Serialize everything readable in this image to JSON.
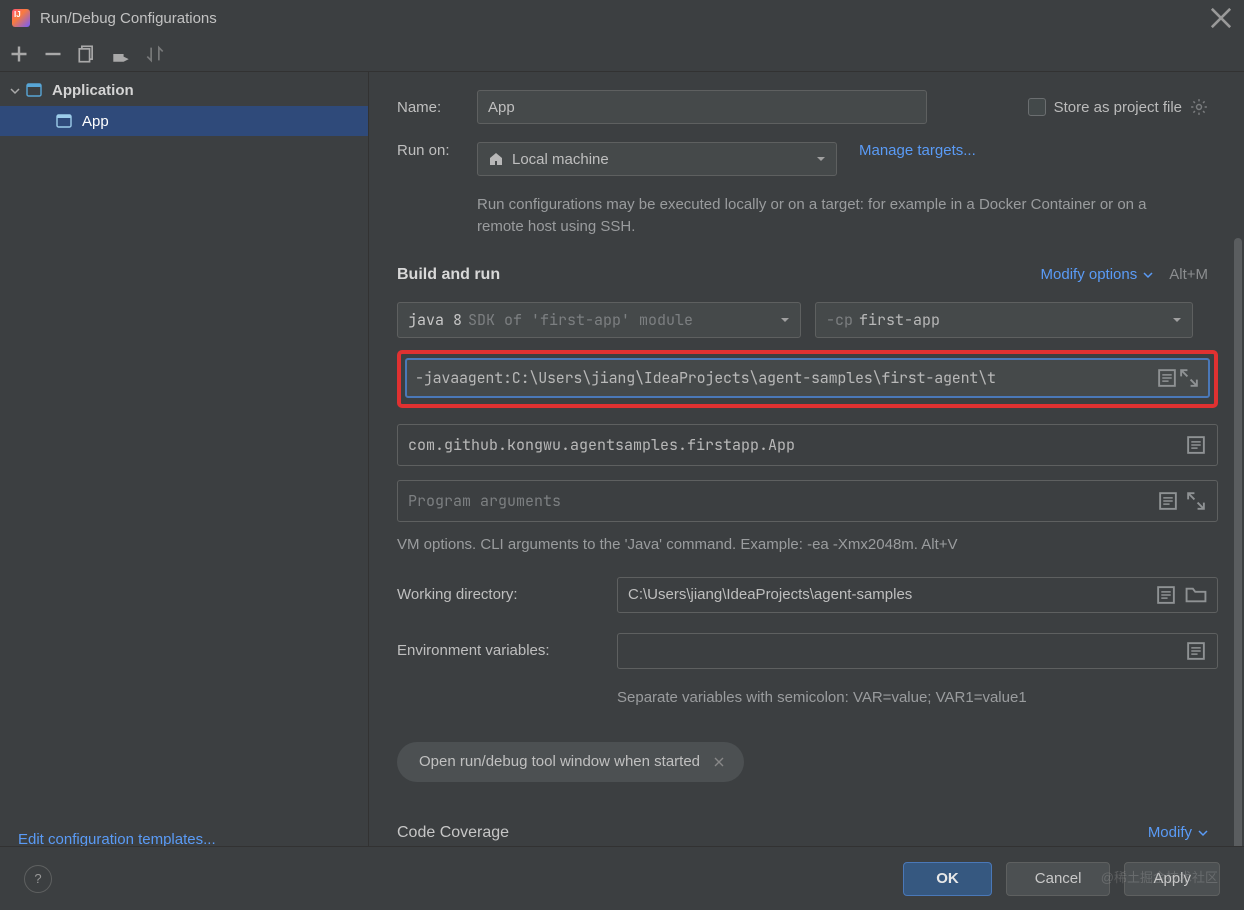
{
  "title": "Run/Debug Configurations",
  "tree": {
    "group": "Application",
    "child": "App"
  },
  "editTemplates": "Edit configuration templates...",
  "name": {
    "label": "Name:",
    "value": "App"
  },
  "store": "Store as project file",
  "runOn": {
    "label": "Run on:",
    "value": "Local machine",
    "manage": "Manage targets..."
  },
  "runHint": "Run configurations may be executed locally or on a target: for example in a Docker Container or on a remote host using SSH.",
  "buildRun": {
    "title": "Build and run",
    "modify": "Modify options",
    "shortcut": "Alt+M"
  },
  "sdk": {
    "main": "java 8",
    "sub": "SDK of 'first-app' module"
  },
  "cp": {
    "pre": "-cp",
    "module": "first-app"
  },
  "vmOptions": "-javaagent:C:\\Users\\jiang\\IdeaProjects\\agent-samples\\first-agent\\t",
  "mainClass": "com.github.kongwu.agentsamples.firstapp.App",
  "progArgsPlaceholder": "Program arguments",
  "vmHelp": "VM options. CLI arguments to the 'Java' command. Example: -ea -Xmx2048m. Alt+V",
  "workingDir": {
    "label": "Working directory:",
    "value": "C:\\Users\\jiang\\IdeaProjects\\agent-samples"
  },
  "envVars": {
    "label": "Environment variables:"
  },
  "envHint": "Separate variables with semicolon: VAR=value; VAR1=value1",
  "chip": "Open run/debug tool window when started",
  "codeCov": {
    "title": "Code Coverage",
    "modify": "Modify"
  },
  "footer": {
    "ok": "OK",
    "cancel": "Cancel",
    "apply": "Apply"
  },
  "watermark": "@稀土掘金技术社区"
}
